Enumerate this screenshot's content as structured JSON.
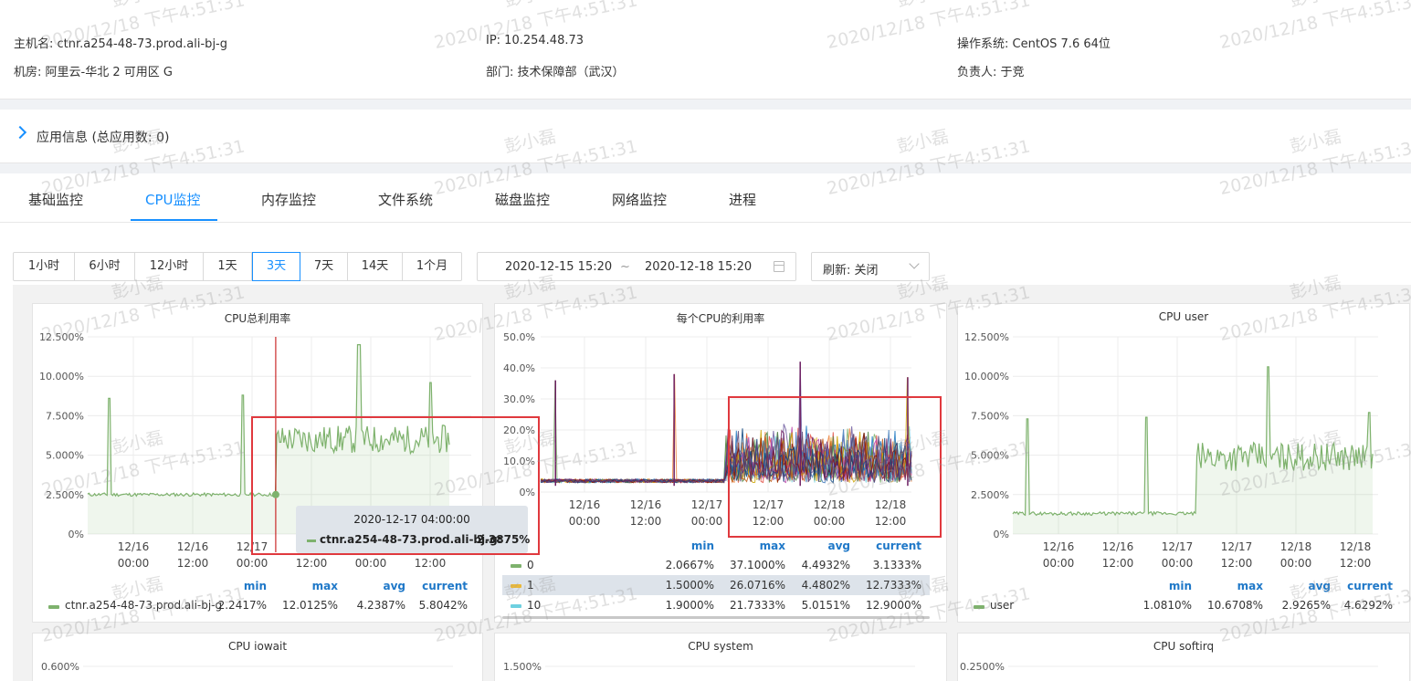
{
  "host": {
    "hostname": "主机名: ctnr.a254-48-73.prod.ali-bj-g",
    "ip": "IP: 10.254.48.73",
    "os": "操作系统: CentOS 7.6 64位",
    "idc": "机房: 阿里云-华北 2 可用区 G",
    "dept": "部门: 技术保障部（武汉）",
    "owner": "负责人: 于竞"
  },
  "app_info": {
    "title": "应用信息 (总应用数: 0)"
  },
  "tabs": [
    "基础监控",
    "CPU监控",
    "内存监控",
    "文件系统",
    "磁盘监控",
    "网络监控",
    "进程"
  ],
  "active_tab": "CPU监控",
  "time_ranges": [
    "1小时",
    "6小时",
    "12小时",
    "1天",
    "3天",
    "7天",
    "14天",
    "1个月"
  ],
  "active_range": "3天",
  "date_range": {
    "start": "2020-12-15 15:20",
    "sep": "~",
    "end": "2020-12-18 15:20"
  },
  "refresh": {
    "label": "刷新: 关闭"
  },
  "colors": {
    "accent": "#1890ff",
    "series_green": "#7eb26d",
    "annotation": "#e0393e"
  },
  "watermark": {
    "name": "彭小磊",
    "time": "2020/12/18 下午4:51:31"
  },
  "tooltip": {
    "time": "2020-12-17 04:00:00",
    "series": "ctnr.a254-48-73.prod.ali-bj-g:",
    "value": "2.3875%"
  },
  "legend_headers": {
    "min": "min",
    "max": "max",
    "avg": "avg",
    "current": "current"
  },
  "chart_data": [
    {
      "type": "area",
      "title": "CPU总利用率",
      "y_ticks": [
        "12.500%",
        "10.000%",
        "7.500%",
        "5.000%",
        "2.500%",
        "0%"
      ],
      "ylim": [
        0,
        12.5
      ],
      "x_ticks": [
        [
          "12/16",
          "00:00"
        ],
        [
          "12/16",
          "12:00"
        ],
        [
          "12/17",
          "00:00"
        ],
        [
          "12/17",
          "12:00"
        ],
        [
          "12/18",
          "00:00"
        ],
        [
          "12/18",
          "12:00"
        ]
      ],
      "series": [
        {
          "name": "ctnr.a254-48-73.prod.ali-bj-g",
          "color": "#7eb26d",
          "min": "2.2417%",
          "max": "12.0125%",
          "avg": "4.2387%",
          "current": "5.8042%"
        }
      ],
      "spikes": [
        [
          0.06,
          8.6
        ],
        [
          0.43,
          8.8
        ],
        [
          0.75,
          12.0
        ],
        [
          0.95,
          9.6
        ]
      ],
      "step": {
        "x": 0.52,
        "before": 2.5,
        "after": 6.0
      },
      "cursor_x": 0.52
    },
    {
      "type": "line",
      "title": "每个CPU的利用率",
      "y_ticks": [
        "50.0%",
        "40.0%",
        "30.0%",
        "20.0%",
        "10.0%",
        "0%"
      ],
      "ylim": [
        0,
        50
      ],
      "x_ticks": [
        [
          "12/16",
          "00:00"
        ],
        [
          "12/16",
          "12:00"
        ],
        [
          "12/17",
          "00:00"
        ],
        [
          "12/17",
          "12:00"
        ],
        [
          "12/18",
          "00:00"
        ],
        [
          "12/18",
          "12:00"
        ]
      ],
      "series": [
        {
          "name": "0",
          "color": "#7eb26d",
          "min": "2.0667%",
          "max": "37.1000%",
          "avg": "4.4932%",
          "current": "3.1333%"
        },
        {
          "name": "1",
          "color": "#eab839",
          "min": "1.5000%",
          "max": "26.0716%",
          "avg": "4.4802%",
          "current": "12.7333%"
        },
        {
          "name": "10",
          "color": "#6ed0e0",
          "min": "1.9000%",
          "max": "21.7333%",
          "avg": "5.0151%",
          "current": "12.9000%"
        }
      ],
      "spikes": [
        [
          0.04,
          36
        ],
        [
          0.36,
          38
        ],
        [
          0.7,
          42
        ],
        [
          0.99,
          37
        ]
      ],
      "step": {
        "x": 0.5,
        "before": 3,
        "after": 12
      }
    },
    {
      "type": "area",
      "title": "CPU user",
      "y_ticks": [
        "12.500%",
        "10.000%",
        "7.500%",
        "5.000%",
        "2.500%",
        "0%"
      ],
      "ylim": [
        0,
        12.5
      ],
      "x_ticks": [
        [
          "12/16",
          "00:00"
        ],
        [
          "12/16",
          "12:00"
        ],
        [
          "12/17",
          "00:00"
        ],
        [
          "12/17",
          "12:00"
        ],
        [
          "12/18",
          "00:00"
        ],
        [
          "12/18",
          "12:00"
        ]
      ],
      "series": [
        {
          "name": "user",
          "color": "#7eb26d",
          "min": "1.0810%",
          "max": "10.6708%",
          "avg": "2.9265%",
          "current": "4.6292%"
        }
      ],
      "spikes": [
        [
          0.04,
          7.3
        ],
        [
          0.37,
          7.4
        ],
        [
          0.71,
          10.6
        ],
        [
          0.99,
          7.7
        ]
      ],
      "step": {
        "x": 0.51,
        "before": 1.3,
        "after": 4.9
      }
    },
    {
      "type": "line",
      "title": "CPU iowait",
      "y_ticks": [
        "0.600%"
      ]
    },
    {
      "type": "line",
      "title": "CPU system",
      "y_ticks": [
        "1.500%"
      ]
    },
    {
      "type": "line",
      "title": "CPU softirq",
      "y_ticks": [
        "0.2500%"
      ]
    }
  ]
}
